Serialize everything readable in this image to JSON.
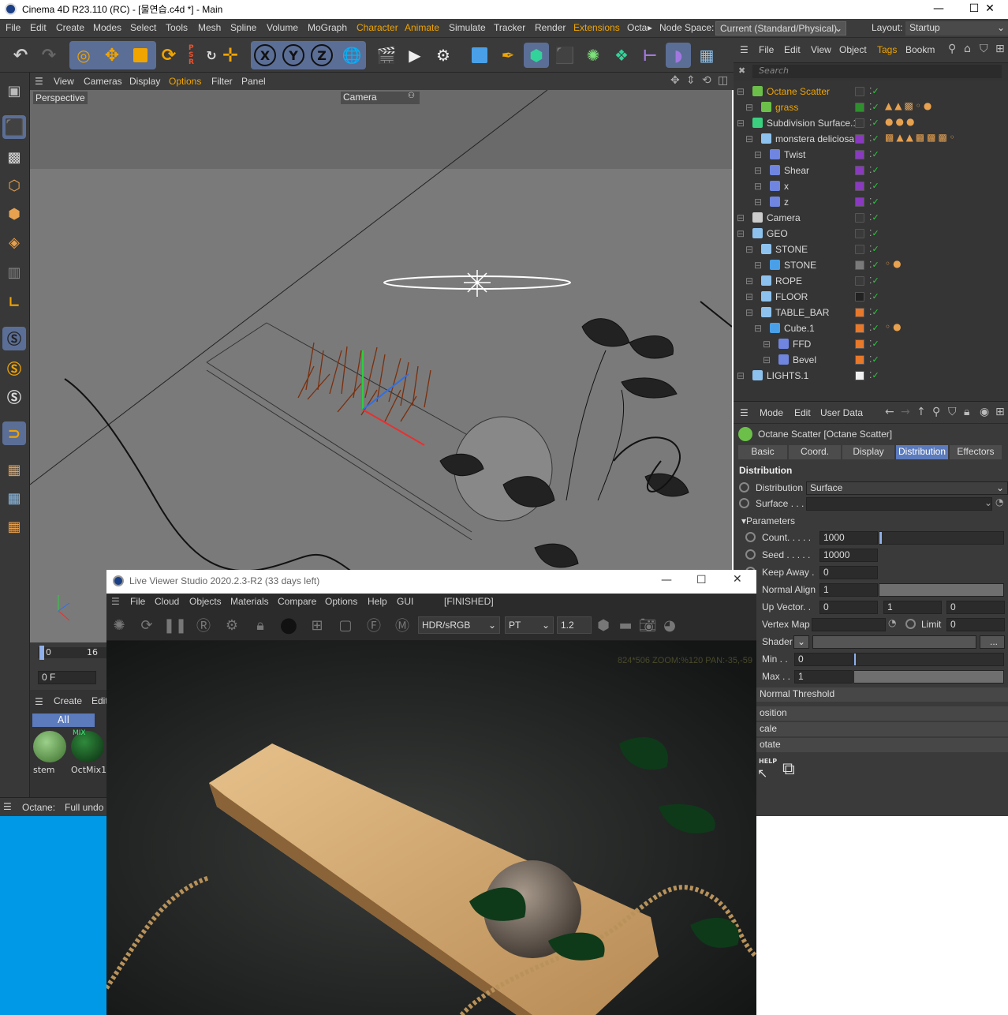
{
  "window": {
    "title": "Cinema 4D R23.110 (RC) - [물연습.c4d *] - Main",
    "minimize": "—",
    "maximize": "☐",
    "close": "✕"
  },
  "menubar": {
    "items": [
      "File",
      "Edit",
      "Create",
      "Modes",
      "Select",
      "Tools",
      "Mesh",
      "Spline",
      "Volume",
      "MoGraph",
      "Character",
      "Animate",
      "Simulate",
      "Tracker",
      "Render",
      "Extensions",
      "Octa"
    ],
    "node_space_label": "Node Space:",
    "node_space_value": "Current (Standard/Physical)",
    "layout_label": "Layout:",
    "layout_value": "Startup",
    "overflow_arrow": "▸"
  },
  "toolbar": {
    "axis_x": "X",
    "axis_y": "Y",
    "axis_z": "Z",
    "psr_label": "P S R"
  },
  "viewport": {
    "menu": [
      "View",
      "Cameras",
      "Display",
      "Options",
      "Filter",
      "Panel"
    ],
    "name": "Perspective",
    "camera": "Camera"
  },
  "timeline": {
    "start": "0",
    "mark": "16",
    "frame": "0 F"
  },
  "materials": {
    "menu": [
      "Create",
      "Edit"
    ],
    "filter": "All",
    "items": [
      {
        "name": "stem",
        "badge": ""
      },
      {
        "name": "OctMix1",
        "badge": "MIX"
      }
    ]
  },
  "statusbar": {
    "label": "Octane:",
    "message": "Full undo"
  },
  "object_manager": {
    "menu": [
      "File",
      "Edit",
      "View",
      "Object",
      "Tags",
      "Bookm"
    ],
    "search_placeholder": "Search",
    "objects": [
      {
        "name": "Octane Scatter",
        "depth": 0,
        "highlight": true,
        "layer_color": "#3a3a3a"
      },
      {
        "name": "grass",
        "depth": 1,
        "highlight": true,
        "layer_color": "#2f8f2f"
      },
      {
        "name": "Subdivision Surface.1",
        "depth": 0,
        "highlight": false,
        "layer_color": "#3a3a3a"
      },
      {
        "name": "monstera deliciosa",
        "depth": 1,
        "highlight": false,
        "layer_color": "#8a3ac0"
      },
      {
        "name": "Twist",
        "depth": 2,
        "highlight": false,
        "layer_color": "#8a3ac0"
      },
      {
        "name": "Shear",
        "depth": 2,
        "highlight": false,
        "layer_color": "#8a3ac0"
      },
      {
        "name": "x",
        "depth": 2,
        "highlight": false,
        "layer_color": "#8a3ac0"
      },
      {
        "name": "z",
        "depth": 2,
        "highlight": false,
        "layer_color": "#8a3ac0"
      },
      {
        "name": "Camera",
        "depth": 0,
        "highlight": false,
        "layer_color": "#3a3a3a"
      },
      {
        "name": "GEO",
        "depth": 0,
        "highlight": false,
        "layer_color": "#3a3a3a"
      },
      {
        "name": "STONE",
        "depth": 1,
        "highlight": false,
        "layer_color": "#3a3a3a"
      },
      {
        "name": "STONE",
        "depth": 2,
        "highlight": false,
        "layer_color": "#7a7a7a"
      },
      {
        "name": "ROPE",
        "depth": 1,
        "highlight": false,
        "layer_color": "#3a3a3a"
      },
      {
        "name": "FLOOR",
        "depth": 1,
        "highlight": false,
        "layer_color": "#222222"
      },
      {
        "name": "TABLE_BAR",
        "depth": 1,
        "highlight": false,
        "layer_color": "#e8782a"
      },
      {
        "name": "Cube.1",
        "depth": 2,
        "highlight": false,
        "layer_color": "#e8782a"
      },
      {
        "name": "FFD",
        "depth": 3,
        "highlight": false,
        "layer_color": "#e8782a"
      },
      {
        "name": "Bevel",
        "depth": 3,
        "highlight": false,
        "layer_color": "#e8782a"
      },
      {
        "name": "LIGHTS.1",
        "depth": 0,
        "highlight": false,
        "layer_color": "#f0f0f0"
      }
    ]
  },
  "attribute_manager": {
    "menu": [
      "Mode",
      "Edit",
      "User Data"
    ],
    "object_title": "Octane Scatter [Octane Scatter]",
    "tabs": [
      "Basic",
      "Coord.",
      "Display",
      "Distribution",
      "Effectors"
    ],
    "active_tab": "Distribution",
    "section_title": "Distribution",
    "distribution_label": "Distribution",
    "distribution_value": "Surface",
    "surface_label": "Surface . . .",
    "surface_value": "",
    "parameters_label": "Parameters",
    "count_label": "Count. . . . .",
    "count_value": "1000",
    "seed_label": "Seed . . . . .",
    "seed_value": "10000",
    "keep_away_label": "Keep Away .",
    "keep_away_value": "0",
    "normal_align_label": "Normal Align",
    "normal_align_value": "1",
    "up_vector_label": "Up Vector. .",
    "up_vector_x": "0",
    "up_vector_y": "1",
    "up_vector_z": "0",
    "vertex_map_label": "Vertex Map",
    "limit_label": "Limit",
    "limit_value": "0",
    "shader_label": "Shader",
    "shader_button": "...",
    "min_label": "Min . .",
    "min_value": "0",
    "max_label": "Max . .",
    "max_value": "1",
    "normal_threshold": "Normal Threshold",
    "position": "osition",
    "scale": "cale",
    "rotate": "otate",
    "help": "HELP"
  },
  "live_viewer": {
    "title": "Live Viewer Studio 2020.2.3-R2 (33 days left)",
    "menu": [
      "File",
      "Cloud",
      "Objects",
      "Materials",
      "Compare",
      "Options",
      "Help",
      "GUI"
    ],
    "status": "[FINISHED]",
    "colorspace": "HDR/sRGB",
    "kernel": "PT",
    "gamma": "1.2",
    "overlay": "824*506 ZOOM:%120   PAN:-35,-59"
  },
  "colors": {
    "accent": "#f0a400",
    "selection": "#5b7bbd",
    "panel": "#3a3a3a",
    "render_bg": "#1d1f1f",
    "desktop_blue": "#0099e8"
  }
}
